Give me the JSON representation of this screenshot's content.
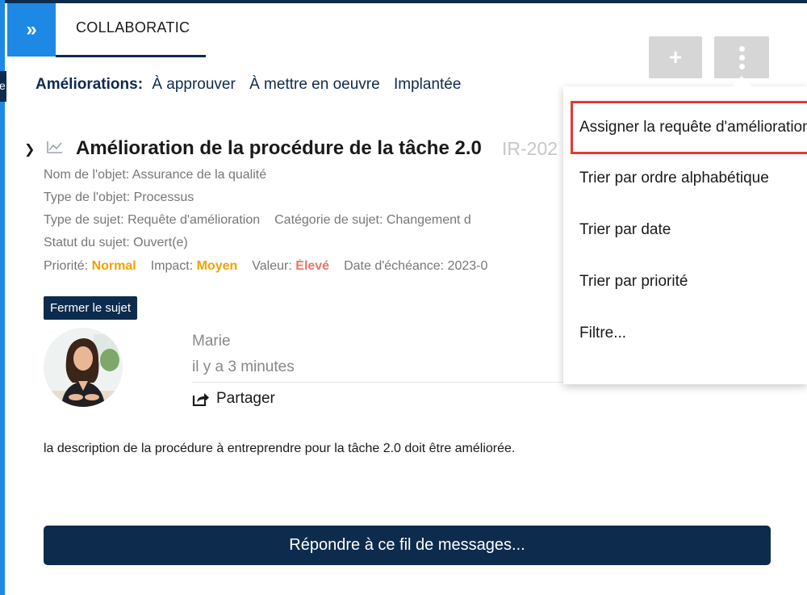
{
  "header": {
    "expand_glyph": "»",
    "tab_title": "COLLABORATIC",
    "side_tab_text": "e"
  },
  "toolbar": {
    "add_label": "+",
    "add_icon": "plus-icon",
    "more_icon": "vertical-dots-icon"
  },
  "filters": {
    "label": "Améliorations:",
    "links": [
      "À approuver",
      "À mettre en oeuvre",
      "Implantée"
    ]
  },
  "subject": {
    "title": "Amélioration de la procédure de la tâche 2.0",
    "id": "IR-202",
    "object_name": "Nom de l'objet: Assurance de la qualité",
    "object_type": "Type de l'objet: Processus",
    "subject_type": "Type de sujet: Requête d'amélioration",
    "subject_category": "Catégorie de sujet: Changement d",
    "status": "Statut du sujet: Ouvert(e)",
    "priority_label": "Priorité:",
    "priority_value": "Normal",
    "impact_label": "Impact:",
    "impact_value": "Moyen",
    "value_label": "Valeur:",
    "value_value": "Élevé",
    "due_date": "Date d'échéance: 2023-0",
    "close_label": "Fermer le sujet"
  },
  "post": {
    "author": "Marie",
    "time": "il y a 3 minutes",
    "share_label": "Partager",
    "description": "la description de la procédure à entreprendre pour la tâche 2.0 doit être améliorée.",
    "reply_label": "Répondre à ce fil de messages..."
  },
  "menu": {
    "items": [
      "Assigner la requête d'amélioration",
      "Trier par ordre alphabétique",
      "Trier par date",
      "Trier par priorité",
      "Filtre..."
    ]
  },
  "colors": {
    "navy": "#0d2b4d",
    "blue": "#1e88e5",
    "priority": "#f2a100",
    "high": "#e8746a",
    "highlight": "#e53935"
  }
}
